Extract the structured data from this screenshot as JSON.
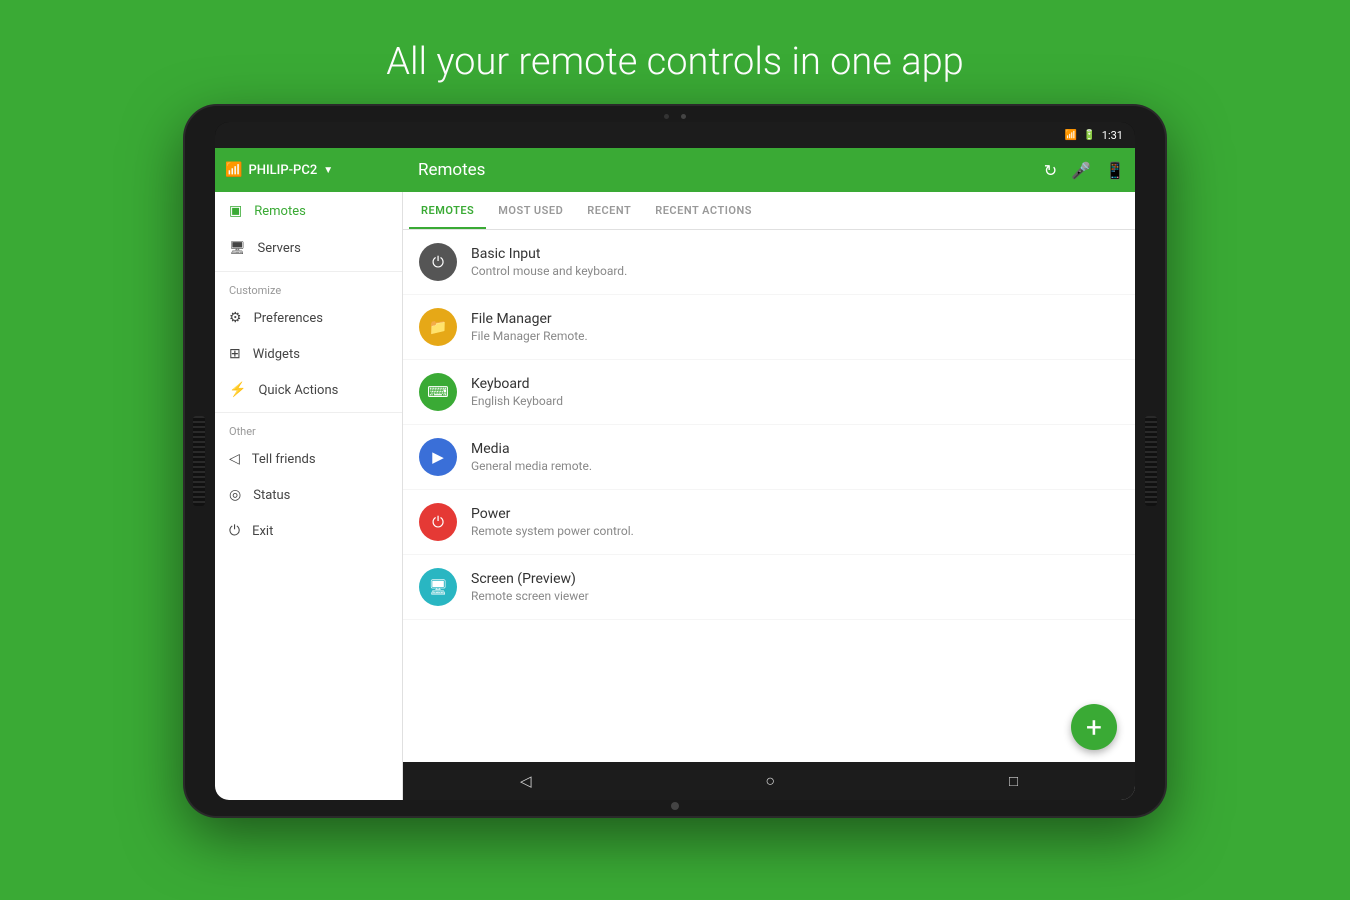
{
  "page": {
    "title": "All your remote controls in one app"
  },
  "status_bar": {
    "battery": "🔋",
    "time": "1:31"
  },
  "toolbar": {
    "network_name": "PHILIP-PC2",
    "section_title": "Remotes",
    "icons": [
      "refresh",
      "mic",
      "phone"
    ]
  },
  "tabs": [
    {
      "id": "remotes",
      "label": "REMOTES",
      "active": true
    },
    {
      "id": "most_used",
      "label": "MOST USED",
      "active": false
    },
    {
      "id": "recent",
      "label": "RECENT",
      "active": false
    },
    {
      "id": "recent_actions",
      "label": "RECENT ACTIONS",
      "active": false
    }
  ],
  "sidebar": {
    "nav_items": [
      {
        "id": "remotes",
        "label": "Remotes",
        "icon": "▣",
        "active": true
      },
      {
        "id": "servers",
        "label": "Servers",
        "icon": "🖥",
        "active": false
      }
    ],
    "customize_label": "Customize",
    "customize_items": [
      {
        "id": "preferences",
        "label": "Preferences",
        "icon": "⚙"
      },
      {
        "id": "widgets",
        "label": "Widgets",
        "icon": "⊞"
      },
      {
        "id": "quick-actions",
        "label": "Quick Actions",
        "icon": "⚡"
      }
    ],
    "other_label": "Other",
    "other_items": [
      {
        "id": "tell-friends",
        "label": "Tell friends",
        "icon": "◁"
      },
      {
        "id": "status",
        "label": "Status",
        "icon": "◎"
      },
      {
        "id": "exit",
        "label": "Exit",
        "icon": "⏻"
      }
    ]
  },
  "remotes": [
    {
      "id": "basic-input",
      "name": "Basic Input",
      "description": "Control mouse and keyboard.",
      "icon_char": "⏻",
      "icon_color": "#444444"
    },
    {
      "id": "file-manager",
      "name": "File Manager",
      "description": "File Manager Remote.",
      "icon_char": "📁",
      "icon_color": "#e6a817"
    },
    {
      "id": "keyboard",
      "name": "Keyboard",
      "description": "English Keyboard",
      "icon_char": "⌨",
      "icon_color": "#3aaa35"
    },
    {
      "id": "media",
      "name": "Media",
      "description": "General media remote.",
      "icon_char": "▶",
      "icon_color": "#3a6fd8"
    },
    {
      "id": "power",
      "name": "Power",
      "description": "Remote system power control.",
      "icon_char": "⏻",
      "icon_color": "#e53935"
    },
    {
      "id": "screen-preview",
      "name": "Screen (Preview)",
      "description": "Remote screen viewer",
      "icon_char": "🖥",
      "icon_color": "#29b6c2"
    }
  ],
  "fab": {
    "label": "+"
  },
  "bottom_nav": {
    "back": "◁",
    "home": "○",
    "recents": "□"
  }
}
